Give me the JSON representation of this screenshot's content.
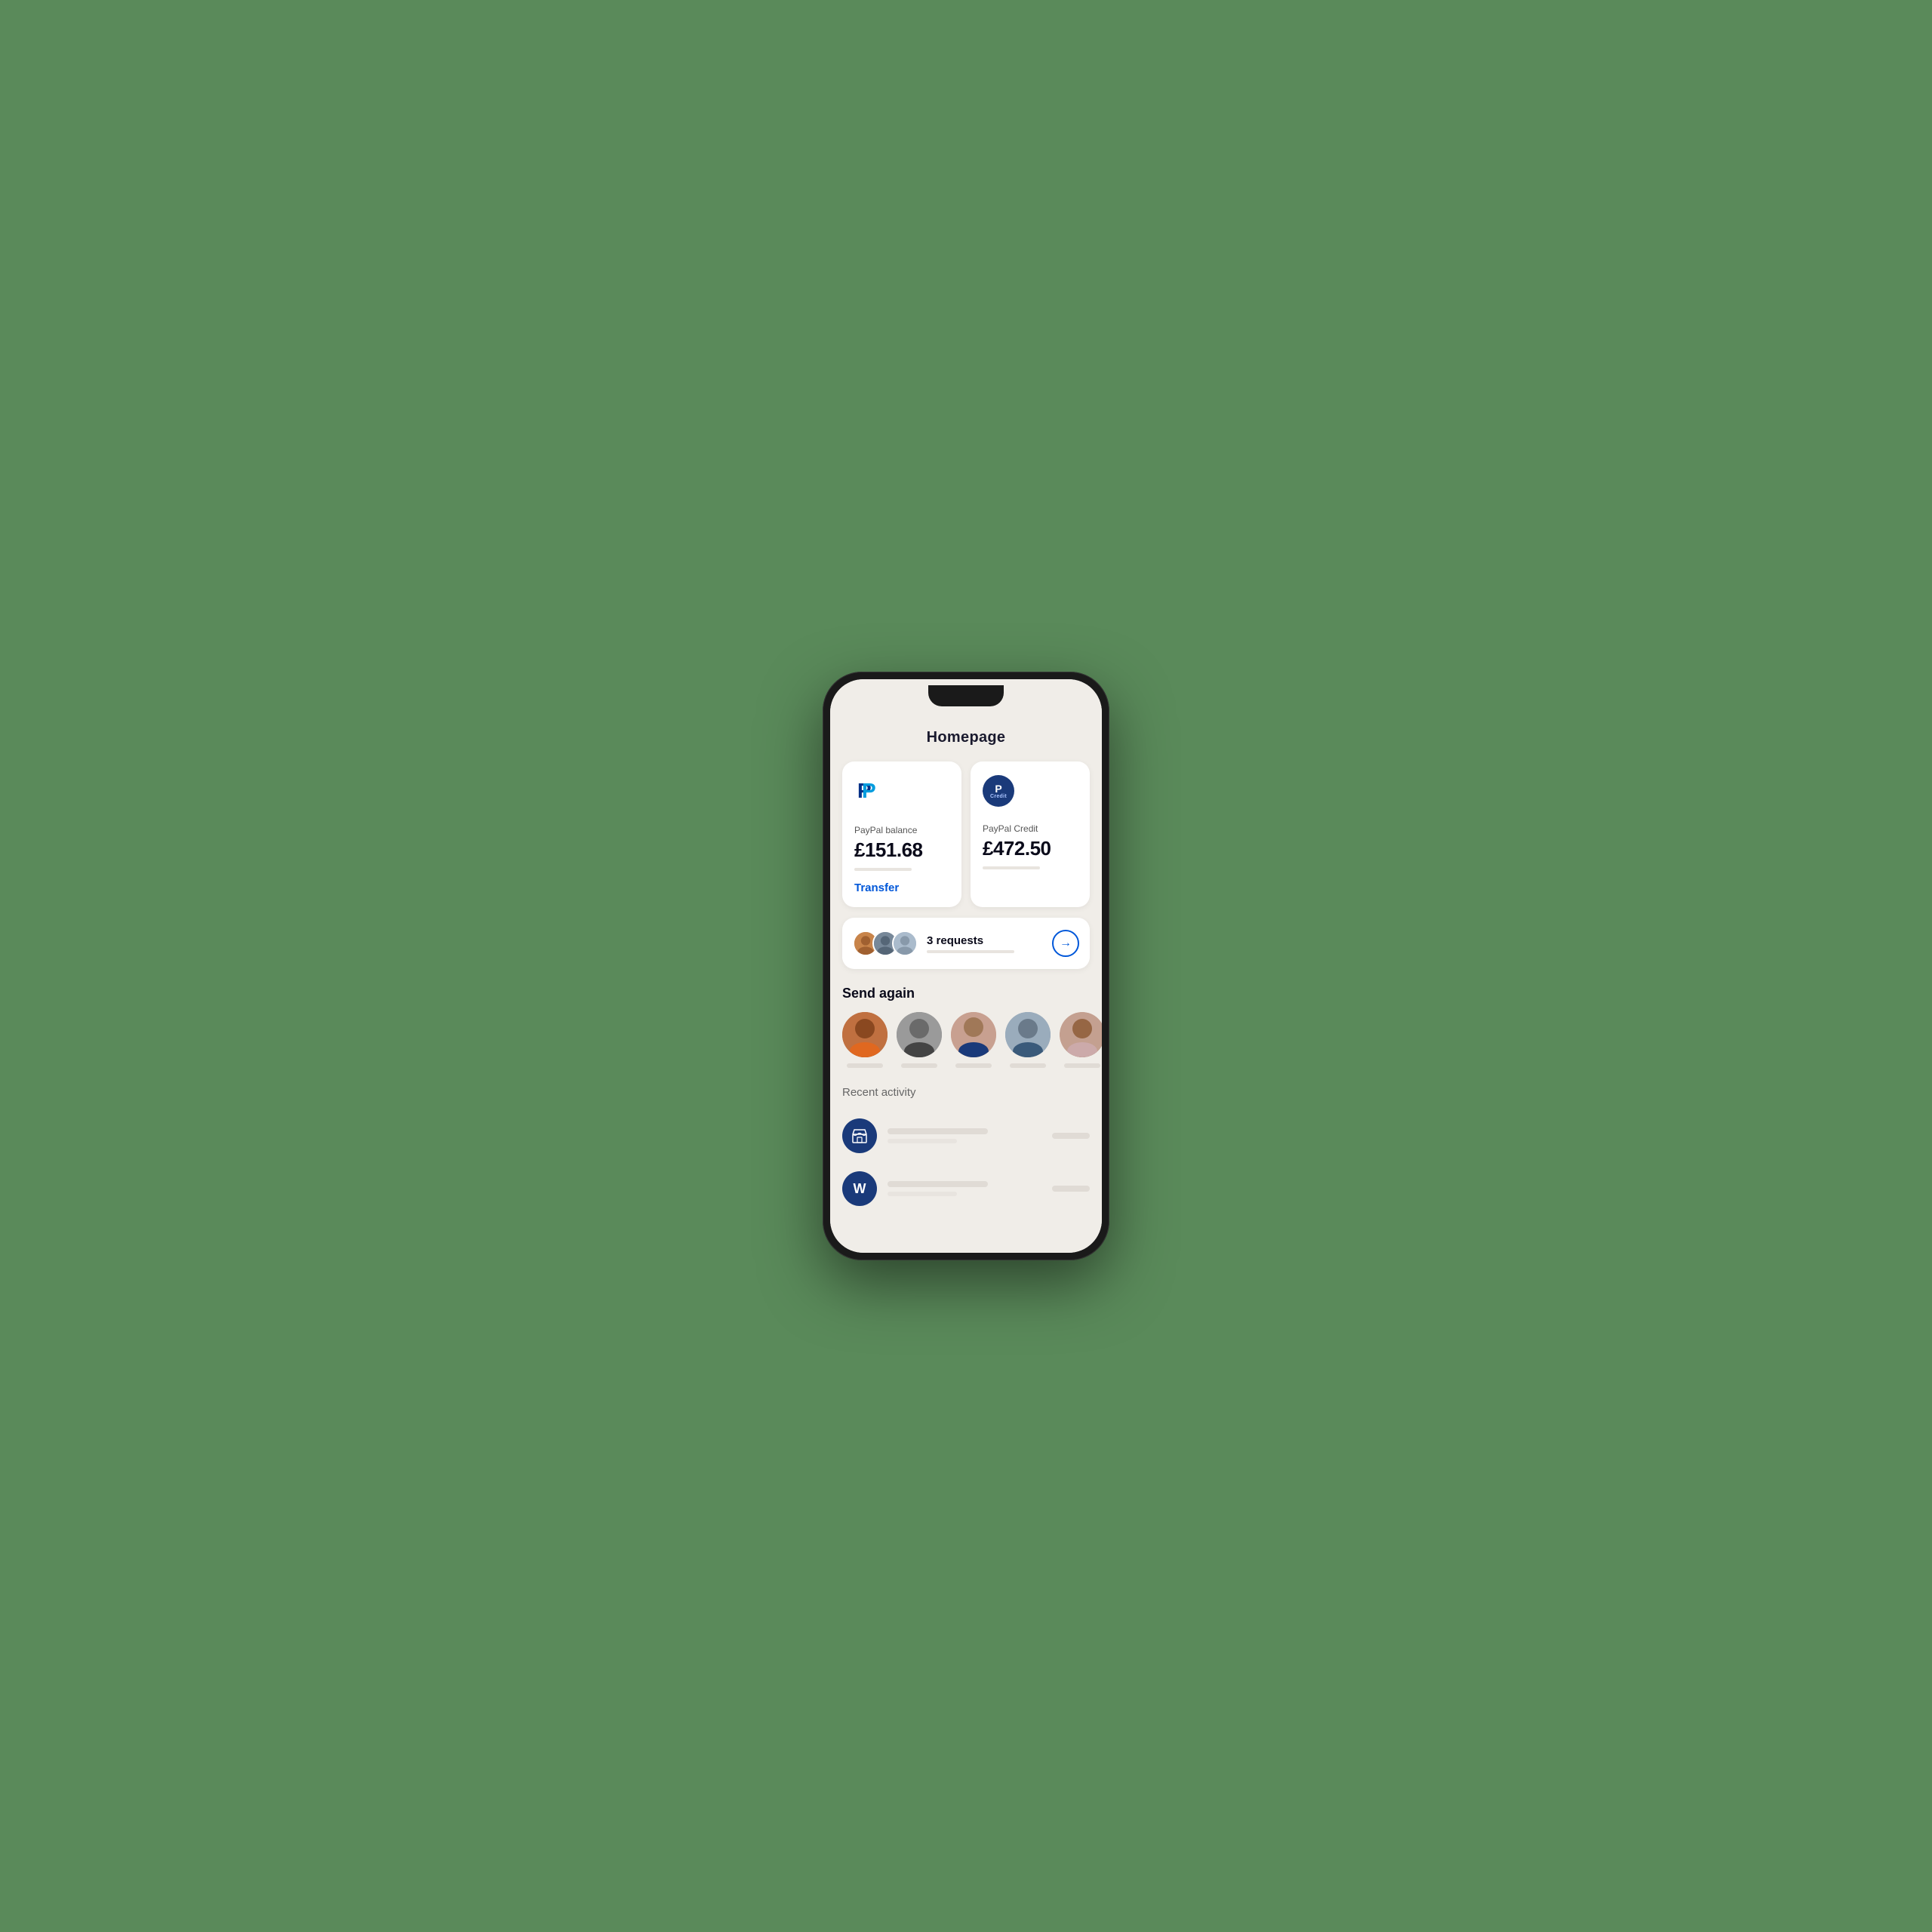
{
  "page": {
    "title": "Homepage",
    "background": "#f0ede8"
  },
  "paypal_balance_card": {
    "label": "PayPal balance",
    "amount": "£151.68",
    "transfer_label": "Transfer"
  },
  "paypal_credit_card": {
    "label": "PayPal Credit",
    "amount": "£472.50",
    "credit_p": "P",
    "credit_sub": "Credit"
  },
  "requests": {
    "label": "3 requests",
    "arrow": "→"
  },
  "send_again": {
    "title": "Send again",
    "contacts": [
      {
        "emoji": "👨🏽",
        "color": "#c8844a"
      },
      {
        "emoji": "👨",
        "color": "#888"
      },
      {
        "emoji": "👩🏻",
        "color": "#d4b0a0"
      },
      {
        "emoji": "🧑",
        "color": "#8a9ab0"
      },
      {
        "emoji": "👩",
        "color": "#c4a090"
      }
    ]
  },
  "recent_activity": {
    "title": "Recent activity",
    "items": [
      {
        "icon": "🏪",
        "bg": "#1a3a7a"
      },
      {
        "icon": "W",
        "bg": "#1a3a7a"
      }
    ]
  },
  "icons": {
    "paypal_p": "𝐏",
    "store": "🏪",
    "w_letter": "W"
  }
}
